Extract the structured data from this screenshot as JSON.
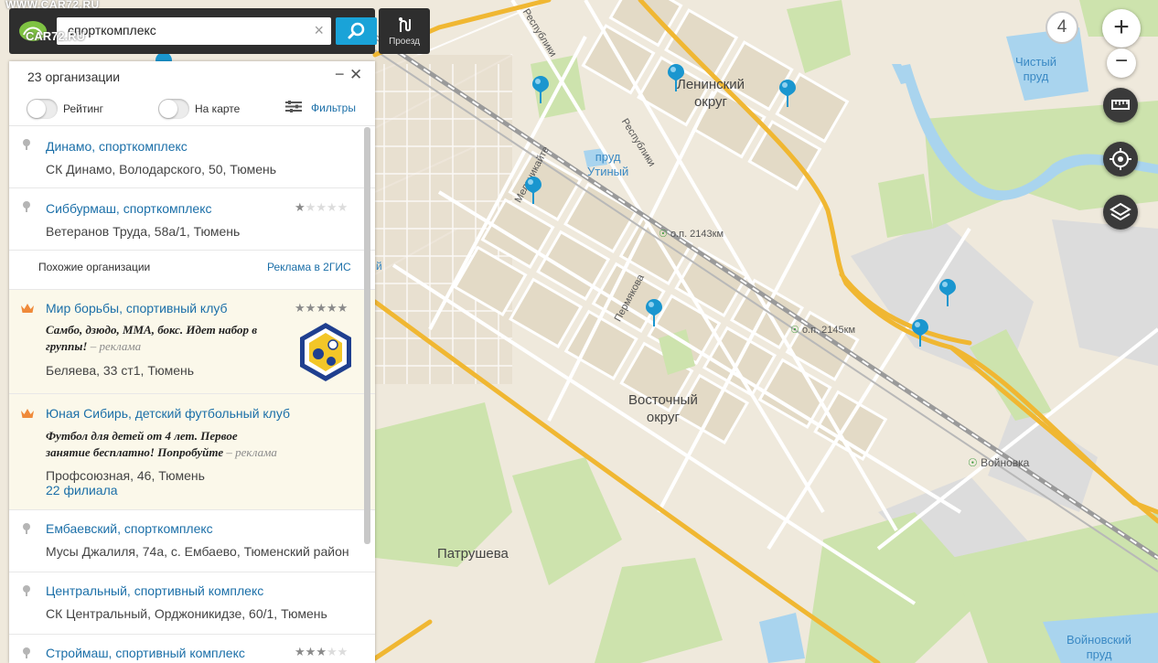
{
  "watermark": "WWW.CAR72.RU",
  "watermark2": "CAR72.RU",
  "search": {
    "query": "спорткомплекс",
    "route_label": "Проезд"
  },
  "panel": {
    "count_label": "23 организации",
    "rating_label": "Рейтинг",
    "on_map_label": "На карте",
    "filters_label": "Фильтры",
    "similar_label": "Похожие организации",
    "similar_ad": "Реклама в 2ГИС"
  },
  "results": [
    {
      "title": "Динамо, спорткомплекс",
      "address": "СК Динамо, Володарского, 50, Тюмень"
    },
    {
      "title": "Сиббурмаш, спорткомплекс",
      "address": "Ветеранов Труда, 58а/1, Тюмень",
      "rating": 1
    },
    {
      "title": "Мир борьбы, спортивный клуб",
      "description": "Самбо, дзюдо, ММА, бокс. Идет набор в группы!",
      "ad_label": "– реклама",
      "address": "Беляева, 33 ст1, Тюмень",
      "rating": 5
    },
    {
      "title": "Юная Сибирь, детский футбольный клуб",
      "description": "Футбол для детей от 4 лет. Первое занятие бесплатно! Попробуйте",
      "ad_label": "– реклама",
      "address": "Профсоюзная, 46, Тюмень",
      "branches": "22 филиала"
    },
    {
      "title": "Ембаевский, спорткомплекс",
      "address": "Мусы Джалиля, 74а, с. Ембаево, Тюменский район"
    },
    {
      "title": "Центральный, спортивный комплекс",
      "address": "СК Центральный, Орджоникидзе, 60/1, Тюмень"
    },
    {
      "title": "Строймаш, спортивный комплекс",
      "rating": 3
    }
  ],
  "map": {
    "zoom_level": "4",
    "labels": {
      "leninsky_1": "Ленинский",
      "leninsky_2": "округ",
      "vostochny_1": "Восточный",
      "vostochny_2": "округ",
      "patrusheva": "Патрушева",
      "pond_utiny_1": "пруд",
      "pond_utiny_2": "Утиный",
      "pond_chisty_1": "Чистый",
      "pond_chisty_2": "пруд",
      "stop_2143": "о.п. 2143км",
      "stop_2145": "о.п. 2145км",
      "voynovka": "Войновка",
      "voynovsky_1": "Войновский",
      "voynovsky_2": "пруд",
      "st_respubliki_1": "Республики",
      "st_respubliki_2": "Республики",
      "st_melnikaite": "Мельникайте",
      "st_permyakova": "Пермякова",
      "edge_letter": "й"
    }
  },
  "colors": {
    "accent": "#1aa3d8",
    "link": "#1b6fa8",
    "ad_bg": "#fbf8ea",
    "road_major": "#f0b732",
    "green": "#cde3ad",
    "water": "#a9d4ee",
    "crown": "#ef8a3a"
  }
}
